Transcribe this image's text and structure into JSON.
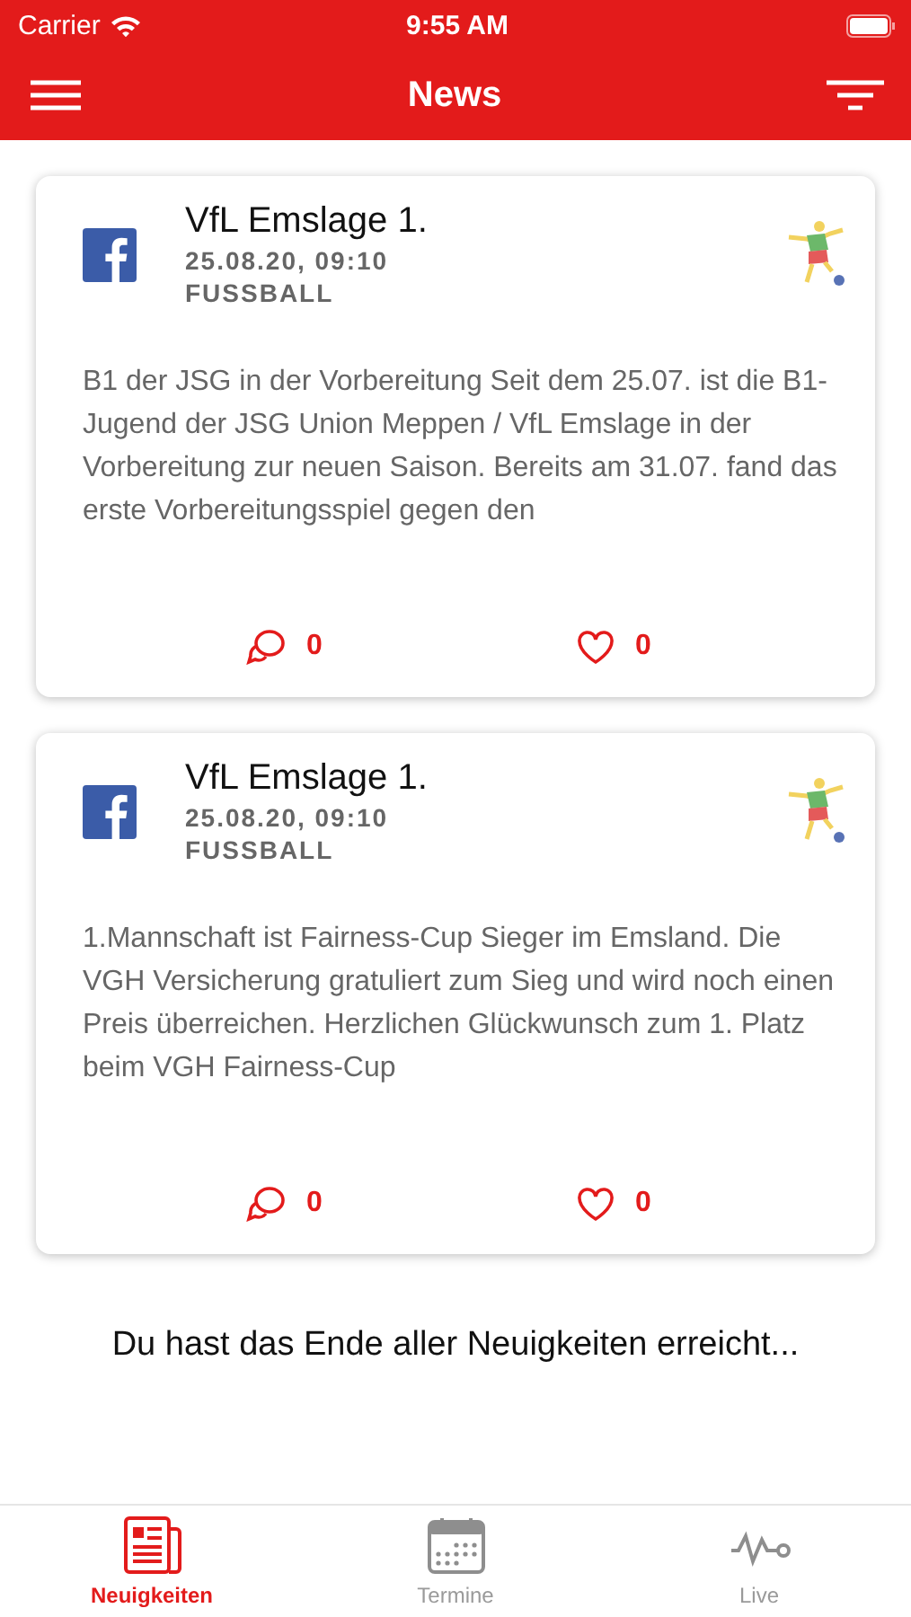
{
  "status_bar": {
    "carrier": "Carrier",
    "time": "9:55 AM"
  },
  "nav": {
    "title": "News"
  },
  "posts": [
    {
      "author": "VfL Emslage 1.",
      "date": "25.08.20, 09:10",
      "category": "FUSSBALL",
      "text": "B1 der JSG in der Vorbereitung Seit dem 25.07. ist die B1-Jugend der JSG Union Meppen / VfL Emslage in der Vorbereitung zur neuen Saison. Bereits am 31.07. fand das erste Vorbereitungsspiel gegen den",
      "comments": "0",
      "likes": "0"
    },
    {
      "author": "VfL Emslage 1.",
      "date": "25.08.20, 09:10",
      "category": "FUSSBALL",
      "text": "1.Mannschaft ist Fairness-Cup Sieger im Emsland. Die VGH Versicherung gratuliert zum Sieg und wird noch einen Preis überreichen. Herzlichen Glückwunsch zum 1. Platz beim VGH Fairness-Cup",
      "comments": "0",
      "likes": "0"
    }
  ],
  "end_message": "Du hast das Ende aller Neuigkeiten erreicht...",
  "tabs": [
    {
      "label": "Neuigkeiten",
      "kind": "news",
      "selected": true
    },
    {
      "label": "Termine",
      "kind": "calendar",
      "selected": false
    },
    {
      "label": "Live",
      "kind": "live",
      "selected": false
    }
  ]
}
